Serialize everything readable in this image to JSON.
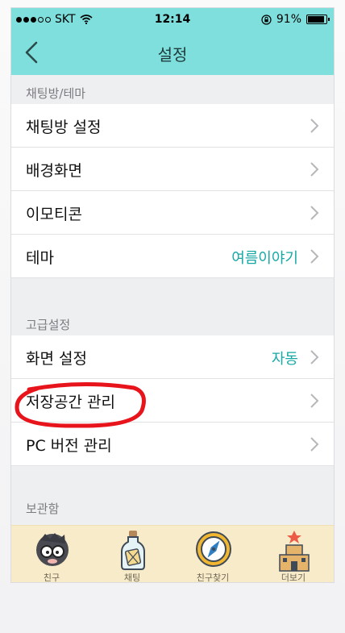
{
  "status_bar": {
    "carrier": "SKT",
    "time": "12:14",
    "battery": "91%"
  },
  "nav": {
    "title": "설정"
  },
  "sections": [
    {
      "header": "채팅방/테마"
    },
    {
      "header": "고급설정"
    },
    {
      "header": "보관함"
    }
  ],
  "rows": [
    {
      "label": "채팅방 설정",
      "value": ""
    },
    {
      "label": "배경화면",
      "value": ""
    },
    {
      "label": "이모티콘",
      "value": ""
    },
    {
      "label": "테마",
      "value": "여름이야기"
    },
    {
      "label": "화면 설정",
      "value": "자동"
    },
    {
      "label": "저장공간 관리",
      "value": ""
    },
    {
      "label": "PC 버전 관리",
      "value": ""
    }
  ],
  "tabbar": {
    "items": [
      {
        "label": "친구",
        "icon": "friends-icon"
      },
      {
        "label": "채팅",
        "icon": "chat-bottle-icon"
      },
      {
        "label": "친구찾기",
        "icon": "compass-icon"
      },
      {
        "label": "더보기",
        "icon": "sandcastle-icon"
      }
    ]
  },
  "colors": {
    "header": "#7fdfdd",
    "accent_value": "#16a8a4",
    "highlight": "#e8141c",
    "tabbar": "#f8ebca"
  }
}
